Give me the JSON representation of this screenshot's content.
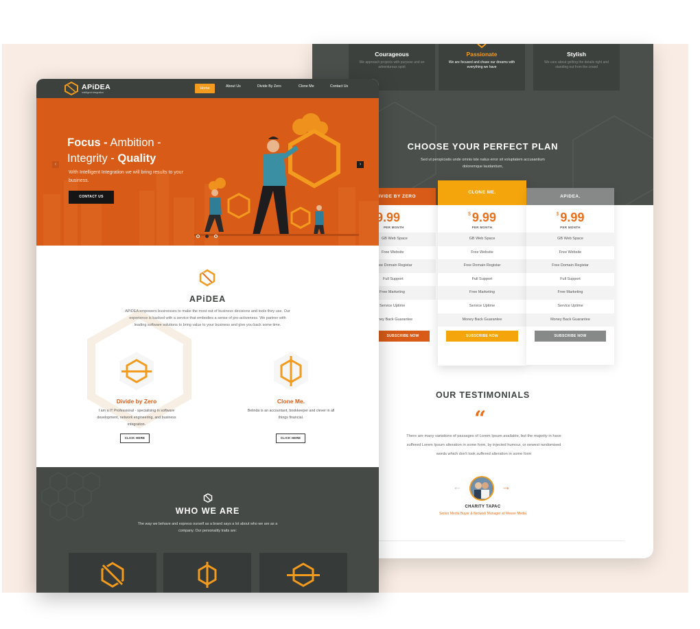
{
  "colors": {
    "orange": "#d85b18",
    "accent": "#f39b1e",
    "dark": "#3c413e",
    "gray": "#7a7d7b"
  },
  "nav": {
    "logo_name": "APiDEA",
    "logo_tag": "intelligent integration",
    "items": [
      "Home",
      "About Us",
      "Divide By Zero",
      "Clone Me",
      "Contact Us"
    ]
  },
  "hero": {
    "title_b1": "Focus -",
    "title_l1": " Ambition -",
    "title_l2": "Integrity - ",
    "title_b2": "Quality",
    "text": "With Intelligent Integration we will bring results to your business.",
    "button": "CONTACT US"
  },
  "about": {
    "title": "APiDEA",
    "text": "APiDEA empowers businesses to make the most out of business decisions and tools they use. Our experience is backed with a service that embodies a sense of pro-activeness. We partner with leading software solutions to bring value to your business and give you back some time."
  },
  "services": [
    {
      "name": "Divide by Zero",
      "desc": "I am a IT Professional - specialising in software development, network engineering, and business integration.",
      "button": "CLICK HERE"
    },
    {
      "name": "Clone Me.",
      "desc": "Belinda is an accountant, bookkeeper and clever in all things financial.",
      "button": "CLICK HERE"
    }
  ],
  "who": {
    "title": "WHO WE ARE",
    "text": "The way we behave and express ourself as a brand says a lot about who we are as a company. Our personality traits are:"
  },
  "traits": [
    {
      "name": "Courageous",
      "desc": "We approach projects with purpose and an adventurous spirit"
    },
    {
      "name": "Passionate",
      "desc": "We are focused and chase our dreams with everything we have"
    },
    {
      "name": "Stylish",
      "desc": "We care about getting the details right and standing out from the crowd"
    }
  ],
  "pricing": {
    "title": "CHOOSE YOUR PERFECT PLAN",
    "subtitle": "Sed ut perspiciatis unde omnis iste natus error sit voluptatem accusantium doloremque laudantium,",
    "per": "PER MONTH",
    "plans": [
      {
        "name": "IVIDE BY ZERO",
        "currency": "$",
        "price": "9.99",
        "color": "#d85b18",
        "button": "SUBSCRIBE NOW"
      },
      {
        "name": "CLONE ME.",
        "currency": "$",
        "price": "9.99",
        "color": "#f5a50c",
        "button": "SUBSCRIBE NOW"
      },
      {
        "name": "APiDEA.",
        "currency": "$",
        "price": "9.99",
        "color": "#868988",
        "button": "SUBSCRIBE NOW"
      }
    ],
    "features": [
      "GB Web Space",
      "Free Website",
      "Free Domain Registar",
      "Full Support",
      "Free Marketing",
      "Service Uptime",
      "Money Back Guarantee"
    ],
    "features_cut": [
      "GB Web Space",
      "Free Website",
      "ee Domain Registar",
      "Full Support",
      "Free Marketing",
      "Service Uptime",
      "oney Back Guarantee"
    ]
  },
  "testimonials": {
    "title": "OUR TESTIMONIALS",
    "quote_mark": "“",
    "text": "There are many variations of passages of Lorem Ipsum available, but the majority in have suffered Lorem Ipsum alteration in some form, by injected humour, or newest randomised words which don't look suffered alteration in some form",
    "name": "CHARITY TAPAC",
    "role": "Senior Media Buyer & Network Manager at Weave Media",
    "prev": "←",
    "next": "→"
  }
}
